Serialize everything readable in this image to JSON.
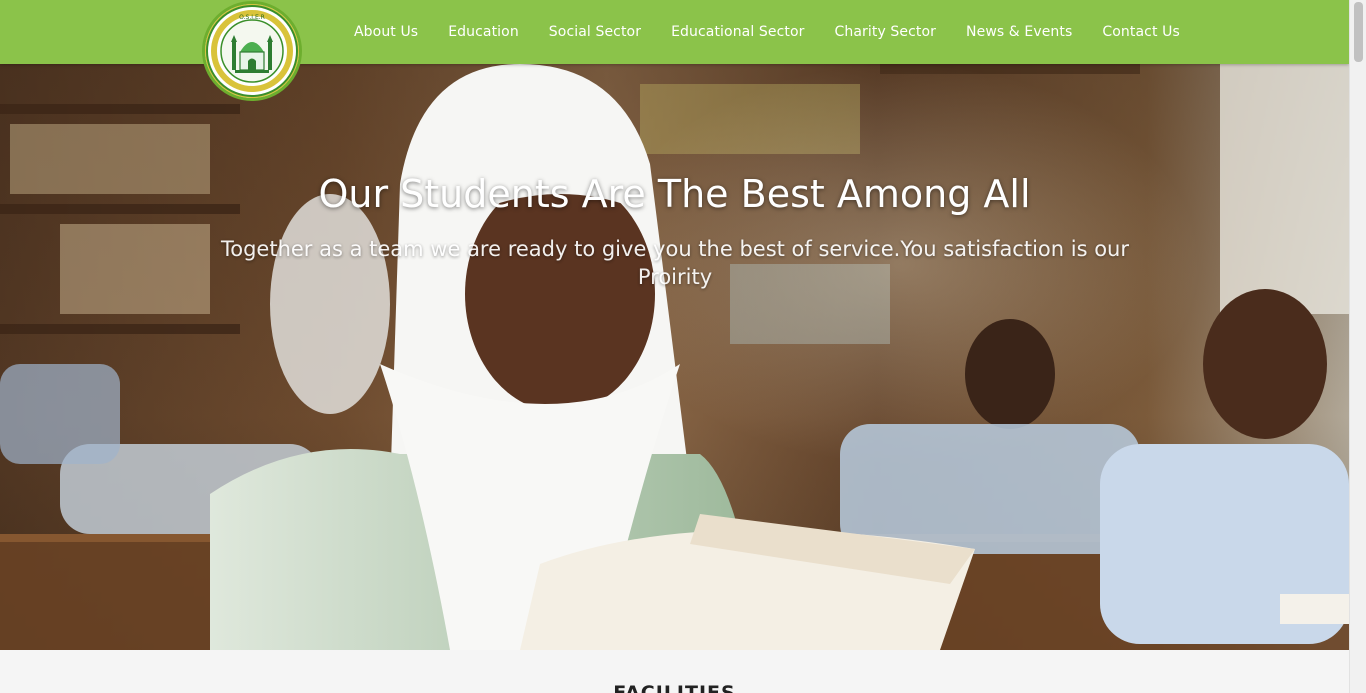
{
  "brand": {
    "logo_icon": "mosque-emblem-logo",
    "logo_text": "O.S.I.E.R",
    "colors": {
      "primary": "#8bc34a",
      "nav_text": "#ffffff"
    }
  },
  "nav": {
    "items": [
      {
        "label": "About Us"
      },
      {
        "label": "Education"
      },
      {
        "label": "Social Sector"
      },
      {
        "label": "Educational Sector"
      },
      {
        "label": "Charity Sector"
      },
      {
        "label": "News & Events"
      },
      {
        "label": "Contact Us"
      }
    ]
  },
  "hero": {
    "title": "Our Students Are The Best Among All",
    "subtitle": "Together as a team we are ready to give you the best of service.You satisfaction is our Proirity"
  },
  "facilities": {
    "title": "FACILITIES"
  }
}
